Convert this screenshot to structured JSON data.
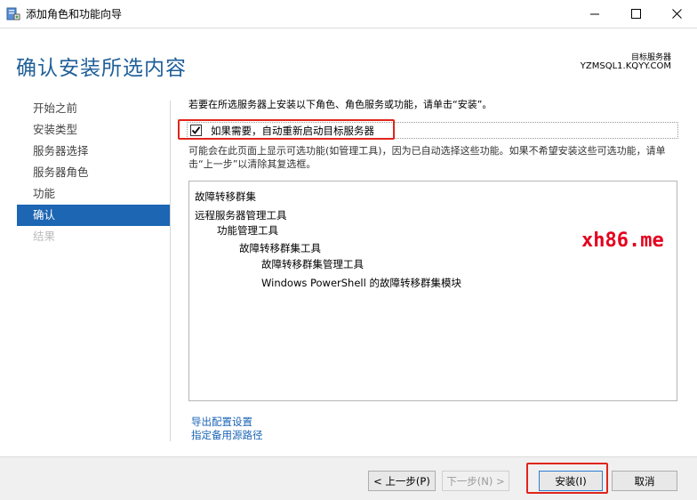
{
  "window": {
    "title": "添加角色和功能向导",
    "minimize_glyph": "—",
    "maximize_glyph": "☐",
    "close_glyph": "✕"
  },
  "header": {
    "page_title": "确认安装所选内容",
    "target_label": "目标服务器",
    "target_server": "YZMSQL1.KQYY.COM"
  },
  "sidebar": {
    "items": [
      {
        "label": "开始之前",
        "state": "normal"
      },
      {
        "label": "安装类型",
        "state": "normal"
      },
      {
        "label": "服务器选择",
        "state": "normal"
      },
      {
        "label": "服务器角色",
        "state": "normal"
      },
      {
        "label": "功能",
        "state": "normal"
      },
      {
        "label": "确认",
        "state": "active"
      },
      {
        "label": "结果",
        "state": "disabled"
      }
    ]
  },
  "content": {
    "intro": "若要在所选服务器上安装以下角色、角色服务或功能，请单击“安装”。",
    "restart_checkbox": {
      "label": "如果需要，自动重新启动目标服务器",
      "checked": true,
      "check_glyph": "✔"
    },
    "note": "可能会在此页面上显示可选功能(如管理工具)，因为已自动选择这些功能。如果不希望安装这些可选功能，请单击“上一步”以清除其复选框。",
    "features": [
      {
        "label": "故障转移群集",
        "level": 0
      },
      {
        "label": "远程服务器管理工具",
        "level": 0
      },
      {
        "label": "功能管理工具",
        "level": 1
      },
      {
        "label": "故障转移群集工具",
        "level": 2
      },
      {
        "label": "故障转移群集管理工具",
        "level": 3
      },
      {
        "label": "Windows PowerShell 的故障转移群集模块",
        "level": 3
      }
    ],
    "export_link": "导出配置设置",
    "source_link": "指定备用源路径"
  },
  "watermark": "xh86.me",
  "footer": {
    "prev_label": "< 上一步(P)",
    "next_label": "下一步(N) >",
    "install_label": "安装(I)",
    "cancel_label": "取消"
  },
  "colors": {
    "title_blue": "#1f5f99",
    "active_nav": "#1c66b3",
    "link_blue": "#1b64b5",
    "highlight_red": "#e0251b",
    "watermark_red": "#e4001e"
  }
}
